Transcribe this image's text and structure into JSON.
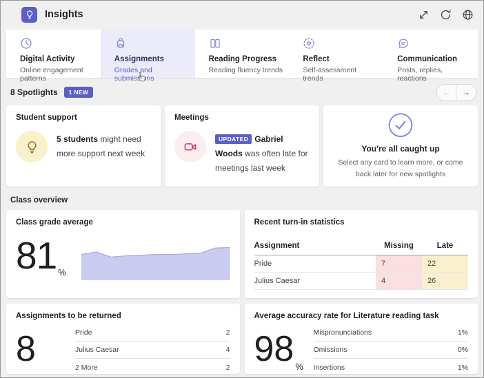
{
  "header": {
    "title": "Insights",
    "actions": [
      {
        "name": "expand",
        "icon": "expand-icon"
      },
      {
        "name": "refresh",
        "icon": "refresh-icon"
      },
      {
        "name": "open-in-browser",
        "icon": "globe-icon"
      }
    ]
  },
  "tabs": [
    {
      "label": "Digital Activity",
      "sublabel": "Online engagement patterns",
      "icon": "clock-icon",
      "selected": false
    },
    {
      "label": "Assignments",
      "sublabel": "Grades and submissions",
      "icon": "backpack-icon",
      "selected": true
    },
    {
      "label": "Reading Progress",
      "sublabel": "Reading fluency trends",
      "icon": "open-book-icon",
      "selected": false
    },
    {
      "label": "Reflect",
      "sublabel": "Self-assessment trends",
      "icon": "heart-badge-icon",
      "selected": false
    },
    {
      "label": "Communication",
      "sublabel": "Posts, replies, reactions",
      "icon": "chat-bubble-icon",
      "selected": false
    }
  ],
  "spotlights": {
    "title": "8 Spotlights",
    "new_badge": "1 NEW",
    "pager": {
      "prev": "←",
      "next": "→"
    },
    "support_card": {
      "title": "Student support",
      "bold": "5 students",
      "text": " might need more support next week"
    },
    "meetings_card": {
      "title": "Meetings",
      "badge": "UPDATED",
      "bold": "Gabriel Woods",
      "text": " was often late for meetings last week"
    },
    "caught_up_card": {
      "title": "You're all caught up",
      "text": "Select any card to learn more, or come back later for new spotlights"
    }
  },
  "overview": {
    "section_title": "Class overview",
    "grade_card": {
      "title": "Class grade average",
      "value": "81",
      "unit": "%"
    },
    "turnin_card": {
      "title": "Recent turn-in statistics",
      "columns": {
        "assignment": "Assignment",
        "missing": "Missing",
        "late": "Late"
      },
      "rows": [
        {
          "assignment": "Pride",
          "missing": "7",
          "late": "22"
        },
        {
          "assignment": "Julius Caesar",
          "missing": "4",
          "late": "26"
        }
      ]
    },
    "returned_card": {
      "title": "Assignments to be returned",
      "value": "8",
      "rows": [
        {
          "label": "Pride",
          "value": "2"
        },
        {
          "label": "Julius Caesar",
          "value": "4"
        },
        {
          "label": "2 More",
          "value": "2"
        }
      ]
    },
    "accuracy_card": {
      "title": "Average accuracy rate for Literature reading task",
      "value": "98",
      "unit": "%",
      "rows": [
        {
          "label": "Mispronunciations",
          "value": "1%"
        },
        {
          "label": "Omissions",
          "value": "0%"
        },
        {
          "label": "Insertions",
          "value": "1%"
        }
      ]
    }
  },
  "chart_data": {
    "type": "area",
    "title": "Class grade average trend (sparkline, no axes)",
    "x": [
      0,
      1,
      2,
      3,
      4,
      5,
      6,
      7,
      8,
      9,
      10
    ],
    "values": [
      80,
      82,
      78,
      79,
      79.5,
      80,
      80,
      80.5,
      81,
      85,
      85.5
    ],
    "ylim": [
      60,
      90
    ],
    "grid": false,
    "legend": false,
    "fill_color": "#c9cbf0",
    "line_color": "#a9ace4"
  },
  "colors": {
    "accent": "#5b5fc7",
    "selected_tab_bg": "#ebebfa",
    "page_bg": "#f0f0f0",
    "missing_cell_bg": "#fbdfe2",
    "late_cell_bg": "#faf0cd",
    "support_circle": "#faf0cb",
    "meeting_circle": "#fceef0"
  }
}
